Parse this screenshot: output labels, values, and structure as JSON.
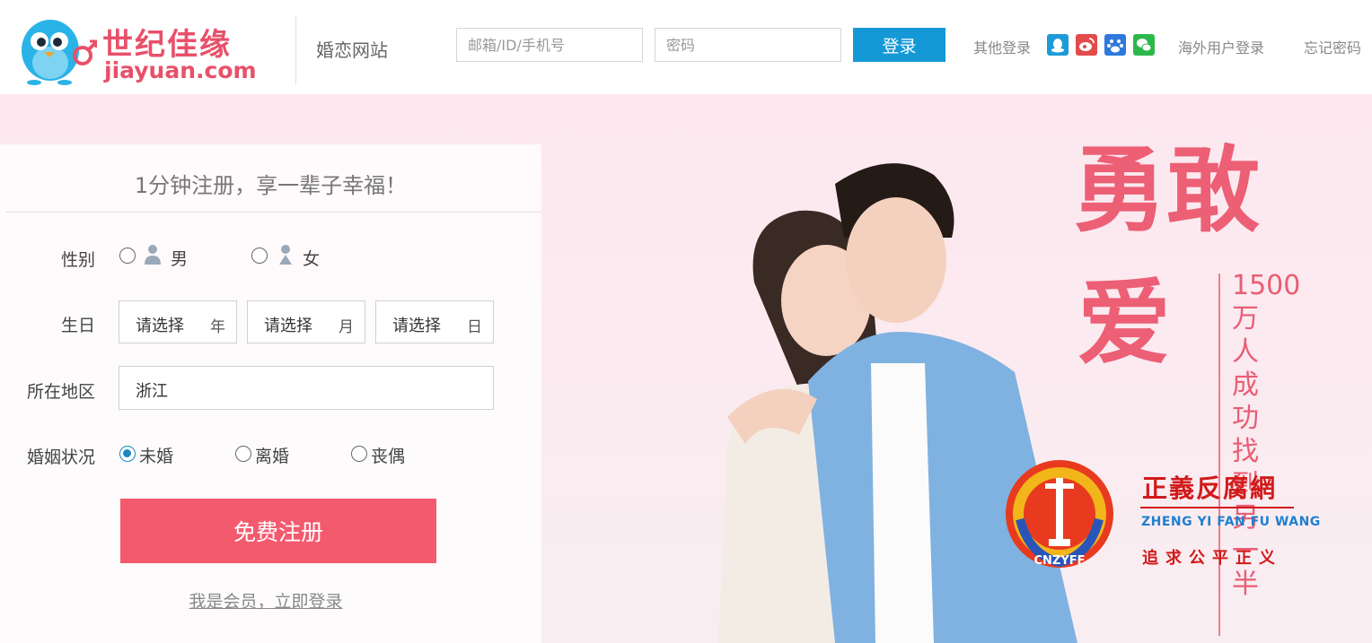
{
  "header": {
    "logo_cn": "世纪佳缘",
    "logo_en": "jiayuan.com",
    "tagline": "婚恋网站",
    "username_placeholder": "邮箱/ID/手机号",
    "password_placeholder": "密码",
    "login_label": "登录",
    "other_login_label": "其他登录",
    "social_icons": [
      "qq-icon",
      "weibo-icon",
      "baidu-icon",
      "wechat-icon"
    ],
    "overseas_login_label": "海外用户登录",
    "forgot_password_label": "忘记密码"
  },
  "register": {
    "title": "1分钟注册，享一辈子幸福！",
    "gender_label": "性别",
    "gender_options": [
      "男",
      "女"
    ],
    "birthday_label": "生日",
    "birthday_selects": [
      {
        "value": "请选择",
        "unit": "年"
      },
      {
        "value": "请选择",
        "unit": "月"
      },
      {
        "value": "请选择",
        "unit": "日"
      }
    ],
    "region_label": "所在地区",
    "region_value": "浙江",
    "marital_label": "婚姻状况",
    "marital_options": [
      "未婚",
      "离婚",
      "丧偶"
    ],
    "marital_selected": "未婚",
    "submit_label": "免费注册",
    "member_login_label": "我是会员，立即登录"
  },
  "banner": {
    "slogan_line1": "勇敢",
    "slogan_line2": "爱",
    "vertical_text": "1500万人成功找到另一半"
  },
  "watermark": {
    "title": "正義反腐網",
    "english": "ZHENG YI FAN FU WANG",
    "subtitle": "追求公平正义",
    "badge_text": "CNZYFF"
  },
  "colors": {
    "brand": "#e8506a",
    "login_button": "#1599d6",
    "register_button": "#f45a6e",
    "radio_checked": "#1b87c7",
    "watermark_red": "#d11a1a"
  }
}
